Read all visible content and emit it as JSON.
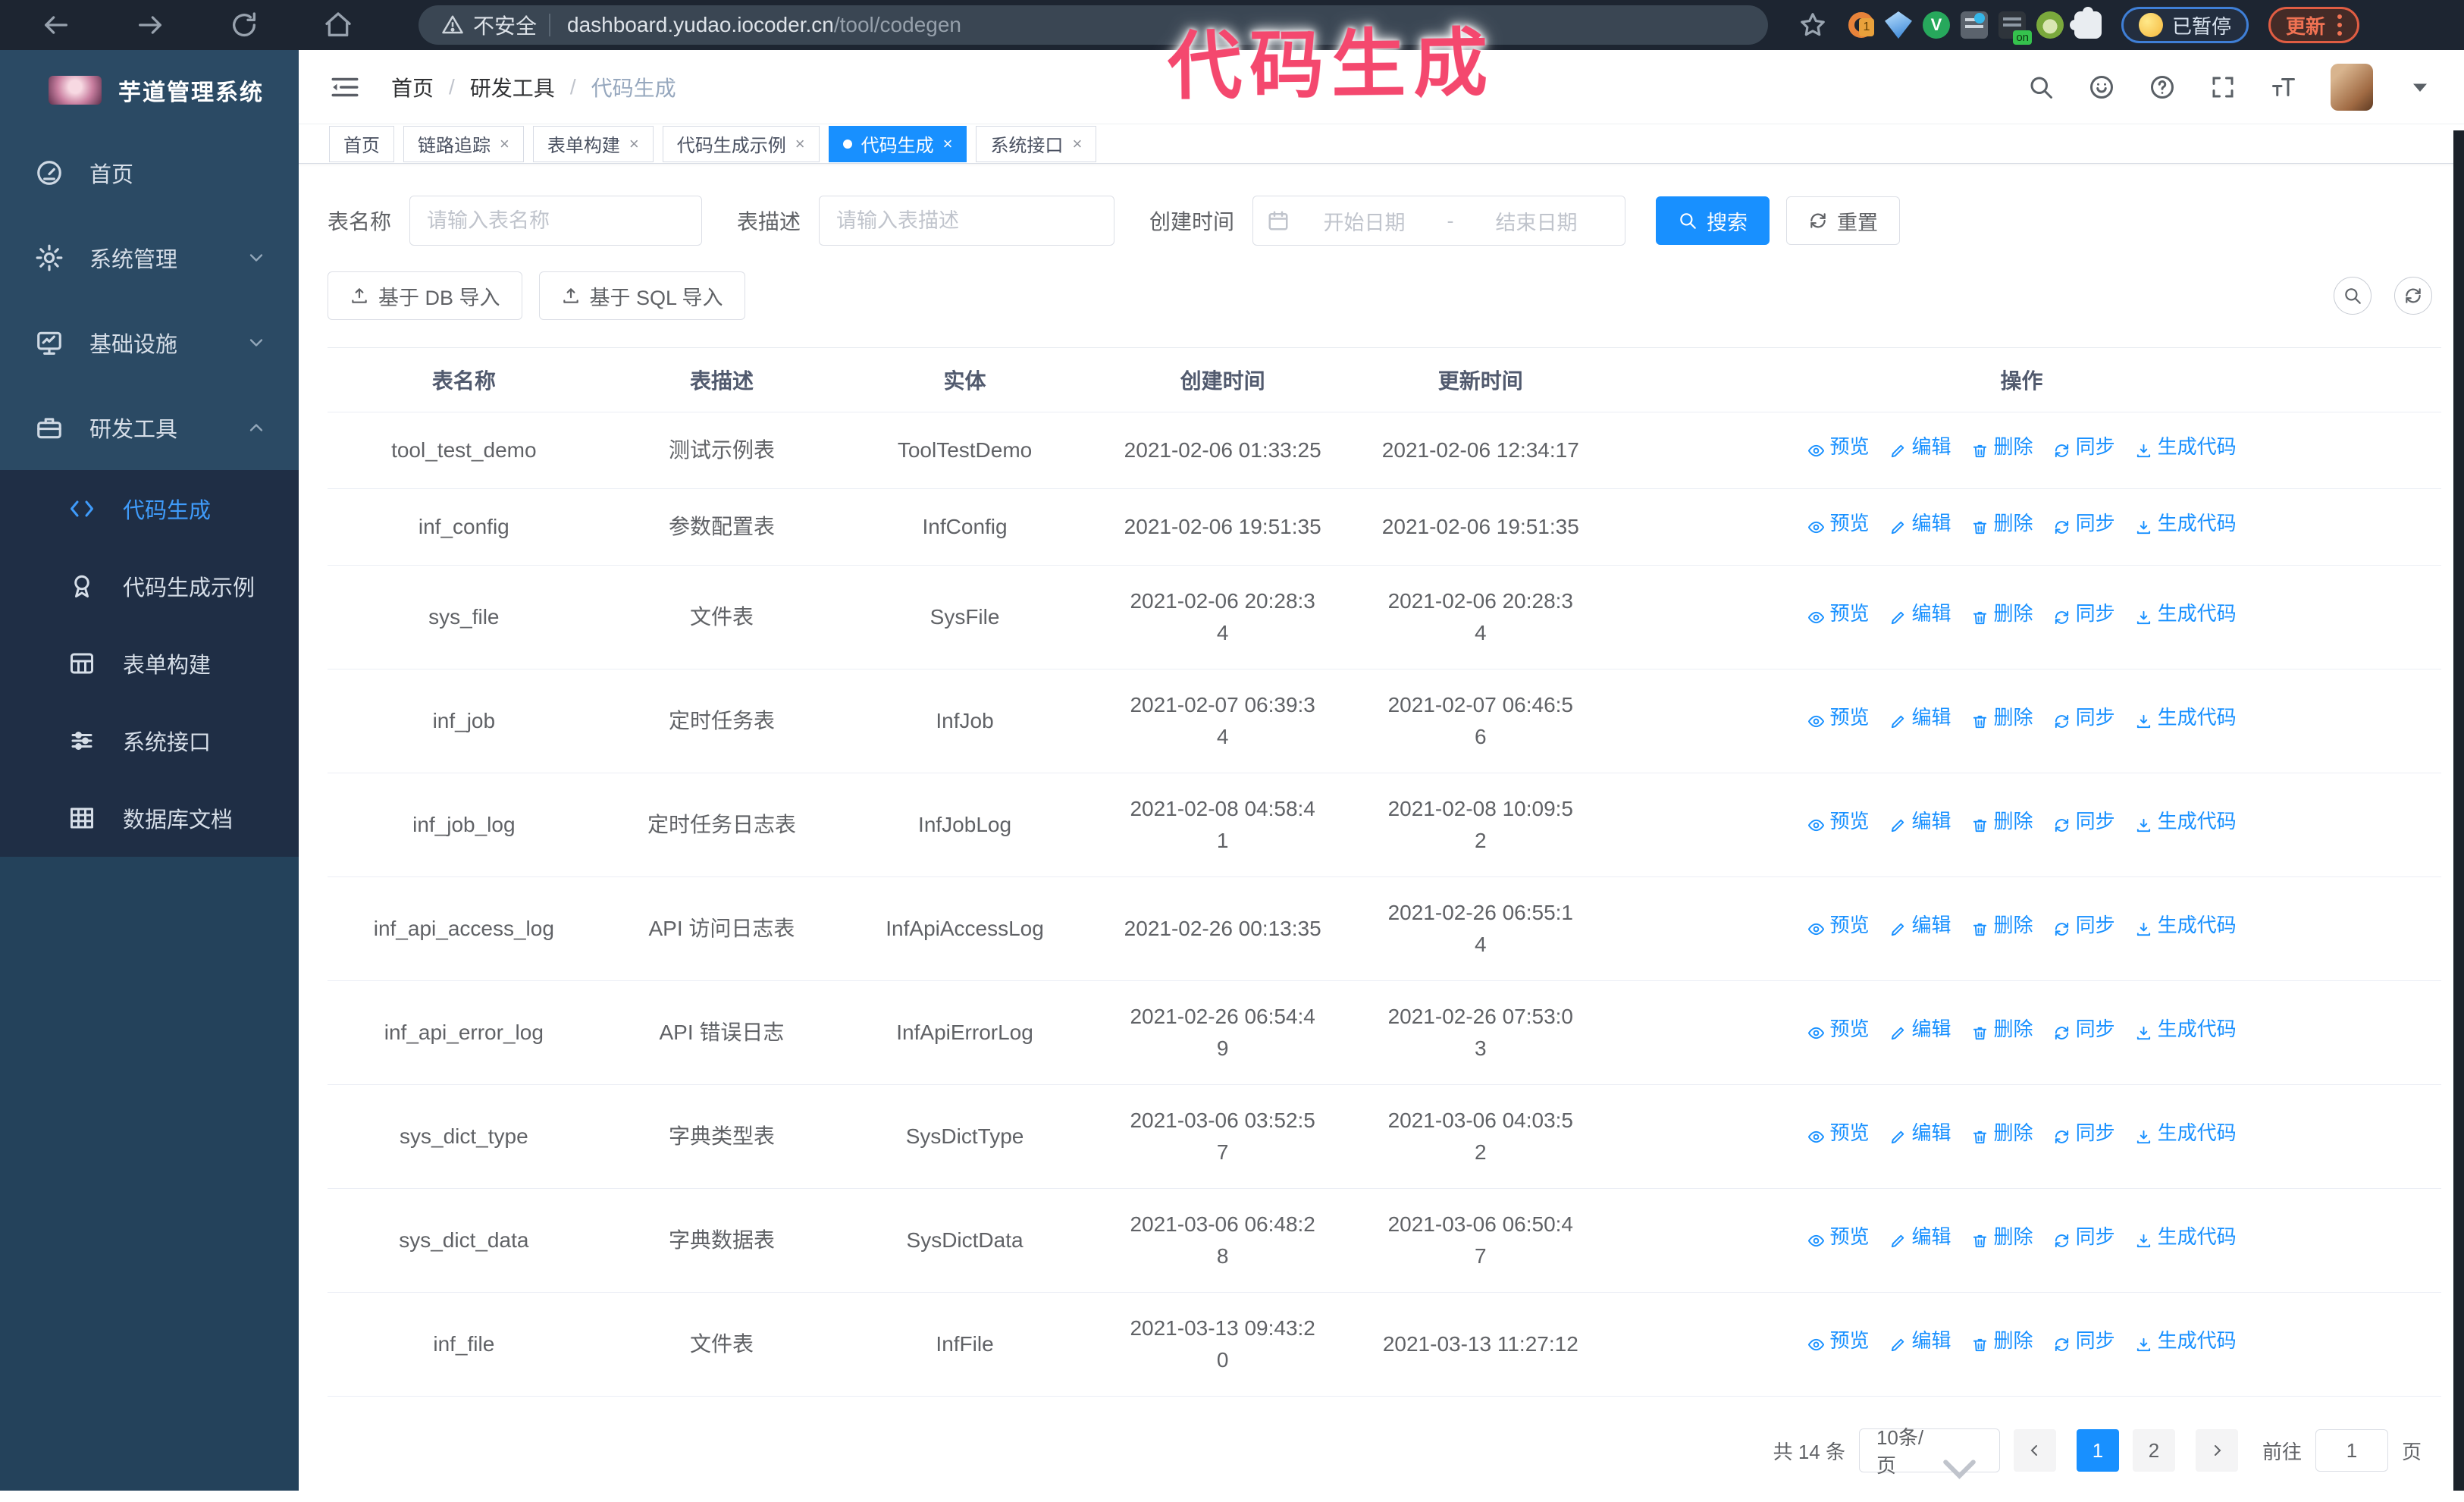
{
  "browser": {
    "security_label": "不安全",
    "url_host": "dashboard.yudao.iocoder.cn",
    "url_path": "/tool/codegen",
    "extension_badge": "1",
    "extension_on_badge": "on",
    "paused_button": "已暂停",
    "update_button": "更新"
  },
  "annotation": {
    "text": "代码生成",
    "color": "#f4486e"
  },
  "sidebar": {
    "title": "芋道管理系统",
    "menu": [
      {
        "label": "首页",
        "icon": "gauge-icon",
        "chevron": "",
        "expanded": false
      },
      {
        "label": "系统管理",
        "icon": "gear-icon",
        "chevron": "down",
        "expanded": false
      },
      {
        "label": "基础设施",
        "icon": "monitor-icon",
        "chevron": "down",
        "expanded": false
      },
      {
        "label": "研发工具",
        "icon": "briefcase-icon",
        "chevron": "up",
        "expanded": true
      }
    ],
    "submenu": [
      {
        "label": "代码生成",
        "icon": "code-icon",
        "active": true
      },
      {
        "label": "代码生成示例",
        "icon": "medal-icon",
        "active": false
      },
      {
        "label": "表单构建",
        "icon": "form-icon",
        "active": false
      },
      {
        "label": "系统接口",
        "icon": "sliders-icon",
        "active": false
      },
      {
        "label": "数据库文档",
        "icon": "dbgrid-icon",
        "active": false
      }
    ]
  },
  "header": {
    "breadcrumb": [
      "首页",
      "研发工具",
      "代码生成"
    ]
  },
  "tabs": [
    {
      "label": "首页",
      "closable": false,
      "active": false
    },
    {
      "label": "链路追踪",
      "closable": true,
      "active": false
    },
    {
      "label": "表单构建",
      "closable": true,
      "active": false
    },
    {
      "label": "代码生成示例",
      "closable": true,
      "active": false
    },
    {
      "label": "代码生成",
      "closable": true,
      "active": true
    },
    {
      "label": "系统接口",
      "closable": true,
      "active": false
    }
  ],
  "filters": {
    "name_label": "表名称",
    "name_placeholder": "请输入表名称",
    "desc_label": "表描述",
    "desc_placeholder": "请输入表描述",
    "time_label": "创建时间",
    "start_placeholder": "开始日期",
    "range_separator": "-",
    "end_placeholder": "结束日期",
    "search_button": "搜索",
    "reset_button": "重置"
  },
  "toolbar": {
    "import_db_button": "基于 DB 导入",
    "import_sql_button": "基于 SQL 导入"
  },
  "table": {
    "columns": [
      "表名称",
      "表描述",
      "实体",
      "创建时间",
      "更新时间",
      "操作"
    ],
    "actions": [
      {
        "label": "预览",
        "icon": "eye-icon"
      },
      {
        "label": "编辑",
        "icon": "edit-icon"
      },
      {
        "label": "删除",
        "icon": "trash-icon"
      },
      {
        "label": "同步",
        "icon": "sync-icon"
      },
      {
        "label": "生成代码",
        "icon": "download-icon"
      }
    ],
    "rows": [
      {
        "name": "tool_test_demo",
        "description": "测试示例表",
        "entity": "ToolTestDemo",
        "created": "2021-02-06 01:33:25",
        "updated": "2021-02-06 12:34:17",
        "created_wrap": false,
        "updated_wrap": false
      },
      {
        "name": "inf_config",
        "description": "参数配置表",
        "entity": "InfConfig",
        "created": "2021-02-06 19:51:35",
        "updated": "2021-02-06 19:51:35",
        "created_wrap": false,
        "updated_wrap": false
      },
      {
        "name": "sys_file",
        "description": "文件表",
        "entity": "SysFile",
        "created": "2021-02-06 20:28:34",
        "updated": "2021-02-06 20:28:34",
        "created_wrap": true,
        "updated_wrap": true
      },
      {
        "name": "inf_job",
        "description": "定时任务表",
        "entity": "InfJob",
        "created": "2021-02-07 06:39:34",
        "updated": "2021-02-07 06:46:56",
        "created_wrap": true,
        "updated_wrap": true
      },
      {
        "name": "inf_job_log",
        "description": "定时任务日志表",
        "entity": "InfJobLog",
        "created": "2021-02-08 04:58:41",
        "updated": "2021-02-08 10:09:52",
        "created_wrap": true,
        "updated_wrap": true
      },
      {
        "name": "inf_api_access_log",
        "description": "API 访问日志表",
        "entity": "InfApiAccessLog",
        "created": "2021-02-26 00:13:35",
        "updated": "2021-02-26 06:55:14",
        "created_wrap": false,
        "updated_wrap": true
      },
      {
        "name": "inf_api_error_log",
        "description": "API 错误日志",
        "entity": "InfApiErrorLog",
        "created": "2021-02-26 06:54:49",
        "updated": "2021-02-26 07:53:03",
        "created_wrap": true,
        "updated_wrap": true
      },
      {
        "name": "sys_dict_type",
        "description": "字典类型表",
        "entity": "SysDictType",
        "created": "2021-03-06 03:52:57",
        "updated": "2021-03-06 04:03:52",
        "created_wrap": true,
        "updated_wrap": true
      },
      {
        "name": "sys_dict_data",
        "description": "字典数据表",
        "entity": "SysDictData",
        "created": "2021-03-06 06:48:28",
        "updated": "2021-03-06 06:50:47",
        "created_wrap": true,
        "updated_wrap": true
      },
      {
        "name": "inf_file",
        "description": "文件表",
        "entity": "InfFile",
        "created": "2021-03-13 09:43:20",
        "updated": "2021-03-13 11:27:12",
        "created_wrap": true,
        "updated_wrap": false
      }
    ]
  },
  "pagination": {
    "total": "共 14 条",
    "page_size": "10条/页",
    "pages": [
      "1",
      "2"
    ],
    "current": "1",
    "goto_label": "前往",
    "goto_value": "1",
    "goto_suffix": "页"
  },
  "colors": {
    "accent": "#1890ff",
    "chrome_bg": "#1d2531",
    "sidebar_top": "#2b4a64",
    "sidebar_submenu": "#1f2e45",
    "sidebar_base": "#24425b",
    "annotation": "#f4486e",
    "active_link": "#3f9bfa"
  }
}
